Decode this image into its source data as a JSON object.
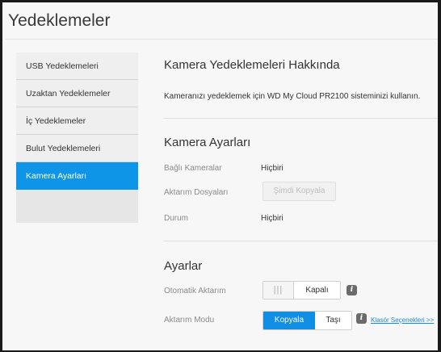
{
  "page": {
    "title": "Yedeklemeler"
  },
  "sidebar": {
    "items": [
      {
        "label": "USB Yedeklemeleri",
        "active": false
      },
      {
        "label": "Uzaktan Yedeklemeler",
        "active": false
      },
      {
        "label": "İç Yedeklemeler",
        "active": false
      },
      {
        "label": "Bulut Yedeklemeleri",
        "active": false
      },
      {
        "label": "Kamera Ayarları",
        "active": true
      }
    ]
  },
  "about": {
    "title": "Kamera Yedeklemeleri Hakkında",
    "text": "Kameranızı yedeklemek için WD My Cloud PR2100 sisteminizi kullanın."
  },
  "camera_settings": {
    "title": "Kamera Ayarları",
    "connected_cameras_label": "Bağlı Kameralar",
    "connected_cameras_value": "Hiçbiri",
    "transfer_files_label": "Aktarım Dosyaları",
    "copy_now_button": "Şimdi Kopyala",
    "status_label": "Durum",
    "status_value": "Hiçbiri"
  },
  "settings": {
    "title": "Ayarlar",
    "auto_transfer_label": "Otomatik Aktarım",
    "auto_transfer_knob": "|||",
    "auto_transfer_value": "Kapalı",
    "transfer_mode_label": "Aktarım Modu",
    "mode_options": [
      "Kopyala",
      "Taşı"
    ],
    "mode_selected": "Kopyala",
    "folder_options_link": "Klasör Seçenekleri >>"
  },
  "colors": {
    "accent": "#0f95e8",
    "link": "#1a8ad8"
  },
  "icons": {
    "info": "info-icon"
  }
}
